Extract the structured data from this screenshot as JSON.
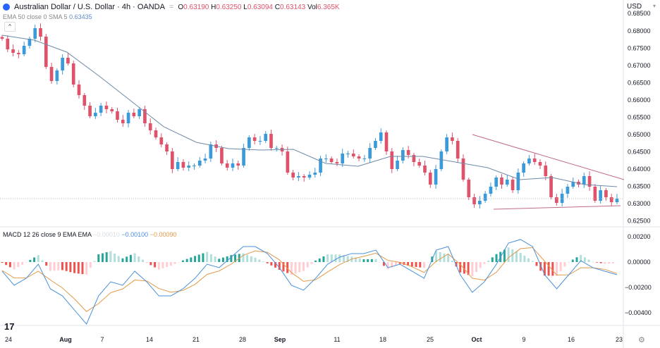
{
  "header": {
    "symbol_title": "Australian Dollar / U.S. Dollar · 4h · OANDA",
    "open_label": "O",
    "open": "0.63190",
    "high_label": "H",
    "high": "0.63250",
    "low_label": "L",
    "low": "0.63094",
    "close_label": "C",
    "close": "0.63143",
    "vol_label": "Vol",
    "vol": "6.365K",
    "currency": "USD"
  },
  "ema_legend": {
    "label": "EMA 50 close 0 SMA 5",
    "value": "0.63435"
  },
  "macd_legend": {
    "label": "MACD 12 26 close 9 EMA EMA",
    "hist": "−0.00010",
    "macd": "−0.00100",
    "signal": "−0.00090"
  },
  "icons": {
    "logo": "tradingview-logo",
    "settings": "gear-icon",
    "collapse": "chevron-up-icon"
  },
  "colors": {
    "up": "#3b9ad9",
    "down": "#e0526a",
    "ema": "#6f8aa8",
    "macd": "#4a90d9",
    "signal": "#e09a4a",
    "hist_up": "#26a69a",
    "hist_down": "#ef5350",
    "trendline": "#c06a8a"
  },
  "chart_data": [
    {
      "type": "candlestick",
      "title": "Australian Dollar / U.S. Dollar · 4h · OANDA",
      "x_tick_labels": [
        "24",
        "Aug",
        "7",
        "14",
        "21",
        "28",
        "Sep",
        "11",
        "18",
        "25",
        "Oct",
        "9",
        "16",
        "23"
      ],
      "y_tick_labels": [
        "0.68000",
        "0.67500",
        "0.67000",
        "0.66500",
        "0.66000",
        "0.65500",
        "0.65000",
        "0.64500",
        "0.64000",
        "0.63500",
        "0.63000",
        "0.62500"
      ],
      "ylim": [
        0.6245,
        0.6825
      ],
      "last_price": 0.63143,
      "closes": [
        0.67776,
        0.67469,
        0.67367,
        0.67327,
        0.67571,
        0.67776,
        0.68082,
        0.67837,
        0.66959,
        0.66551,
        0.66857,
        0.67224,
        0.67061,
        0.66449,
        0.66143,
        0.65837,
        0.65531,
        0.65633,
        0.65837,
        0.65735,
        0.65673,
        0.65429,
        0.65327,
        0.65633,
        0.65531,
        0.65735,
        0.65327,
        0.65122,
        0.64918,
        0.64714,
        0.6451,
        0.64,
        0.64204,
        0.64041,
        0.64102,
        0.64102,
        0.64245,
        0.64306,
        0.64714,
        0.64612,
        0.64163,
        0.64041,
        0.64163,
        0.64102,
        0.64612,
        0.64918,
        0.64816,
        0.64816,
        0.6502,
        0.64612,
        0.64612,
        0.6451,
        0.63898,
        0.63755,
        0.63796,
        0.63755,
        0.63837,
        0.63898,
        0.64306,
        0.64306,
        0.64204,
        0.64163,
        0.64449,
        0.64449,
        0.64367,
        0.64306,
        0.64306,
        0.64612,
        0.64816,
        0.65061,
        0.6451,
        0.64,
        0.64245,
        0.64551,
        0.64408,
        0.64204,
        0.64102,
        0.63898,
        0.63551,
        0.64,
        0.6451,
        0.64918,
        0.64816,
        0.64306,
        0.63694,
        0.63184,
        0.6298,
        0.63082,
        0.63286,
        0.6349,
        0.63755,
        0.63551,
        0.63694,
        0.63388,
        0.63898,
        0.64163,
        0.64306,
        0.64204,
        0.64102,
        0.63796,
        0.63184,
        0.6302,
        0.63286,
        0.6349,
        0.63633,
        0.63551,
        0.63796,
        0.6349,
        0.63082,
        0.63388,
        0.63184,
        0.63041,
        0.63143
      ],
      "ema50": [
        0.67878,
        0.67735,
        0.67388,
        0.66694,
        0.65959,
        0.65224,
        0.64776,
        0.64592,
        0.64551,
        0.64571,
        0.64163,
        0.64082,
        0.64367,
        0.64367,
        0.64204,
        0.64041,
        0.63694,
        0.63755,
        0.63551,
        0.6349
      ],
      "trendlines": {
        "upper": [
          0.65,
          0.63694
        ],
        "lower": [
          0.62837,
          0.62939
        ]
      }
    },
    {
      "type": "line",
      "title": "MACD 12 26 close 9 EMA EMA",
      "y_tick_labels": [
        "0.00200",
        "0.00000",
        "−0.00200",
        "−0.00400"
      ],
      "ylim": [
        -0.0052,
        0.0027
      ],
      "macd": [
        -0.00072,
        -0.00183,
        -0.00128,
        -0.00017,
        -0.00211,
        -0.00267,
        -0.00378,
        -0.00489,
        -0.00267,
        -0.00156,
        -0.00183,
        -0.00072,
        -0.00156,
        -0.00267,
        -0.00267,
        -0.00211,
        -0.00128,
        -0.00017,
        -0.00044,
        0.00039,
        0.00122,
        0.00122,
        0.00067,
        -0.00044,
        -0.00183,
        -0.00222,
        -0.00128,
        -0.00017,
        0.00039,
        0.00067,
        0.00067,
        0.00094,
        -0.00044,
        -0.00017,
        -0.00072,
        -0.00128,
        0.00094,
        0.00122,
        -0.001,
        -0.00239,
        -0.00156,
        -0.00017,
        0.0015,
        0.00178,
        0.00122,
        -0.001,
        -0.00211,
        -0.001,
        0.00011,
        -0.00044,
        -0.00072,
        -0.001
      ],
      "signal": [
        -0.00066,
        -0.00125,
        -0.00126,
        -0.00072,
        -0.00141,
        -0.00204,
        -0.00291,
        -0.0039,
        -0.00328,
        -0.00242,
        -0.00212,
        -0.00142,
        -0.00149,
        -0.00208,
        -0.00238,
        -0.00224,
        -0.00176,
        -0.00097,
        -0.0007,
        -0.00016,
        0.00053,
        0.00088,
        0.00077,
        0.00017,
        -0.00083,
        -0.00152,
        -0.0014,
        -0.00078,
        -0.0002,
        0.00024,
        0.00045,
        0.0007,
        0.00013,
        -2e-05,
        -0.00037,
        -0.00082,
        6e-05,
        0.00064,
        -0.00018,
        -0.00128,
        -0.00142,
        -0.0008,
        0.00035,
        0.00106,
        0.00114,
        7e-05,
        -0.00102,
        -0.00101,
        -0.00045,
        -0.00045,
        -0.00058,
        -0.0009
      ]
    }
  ]
}
